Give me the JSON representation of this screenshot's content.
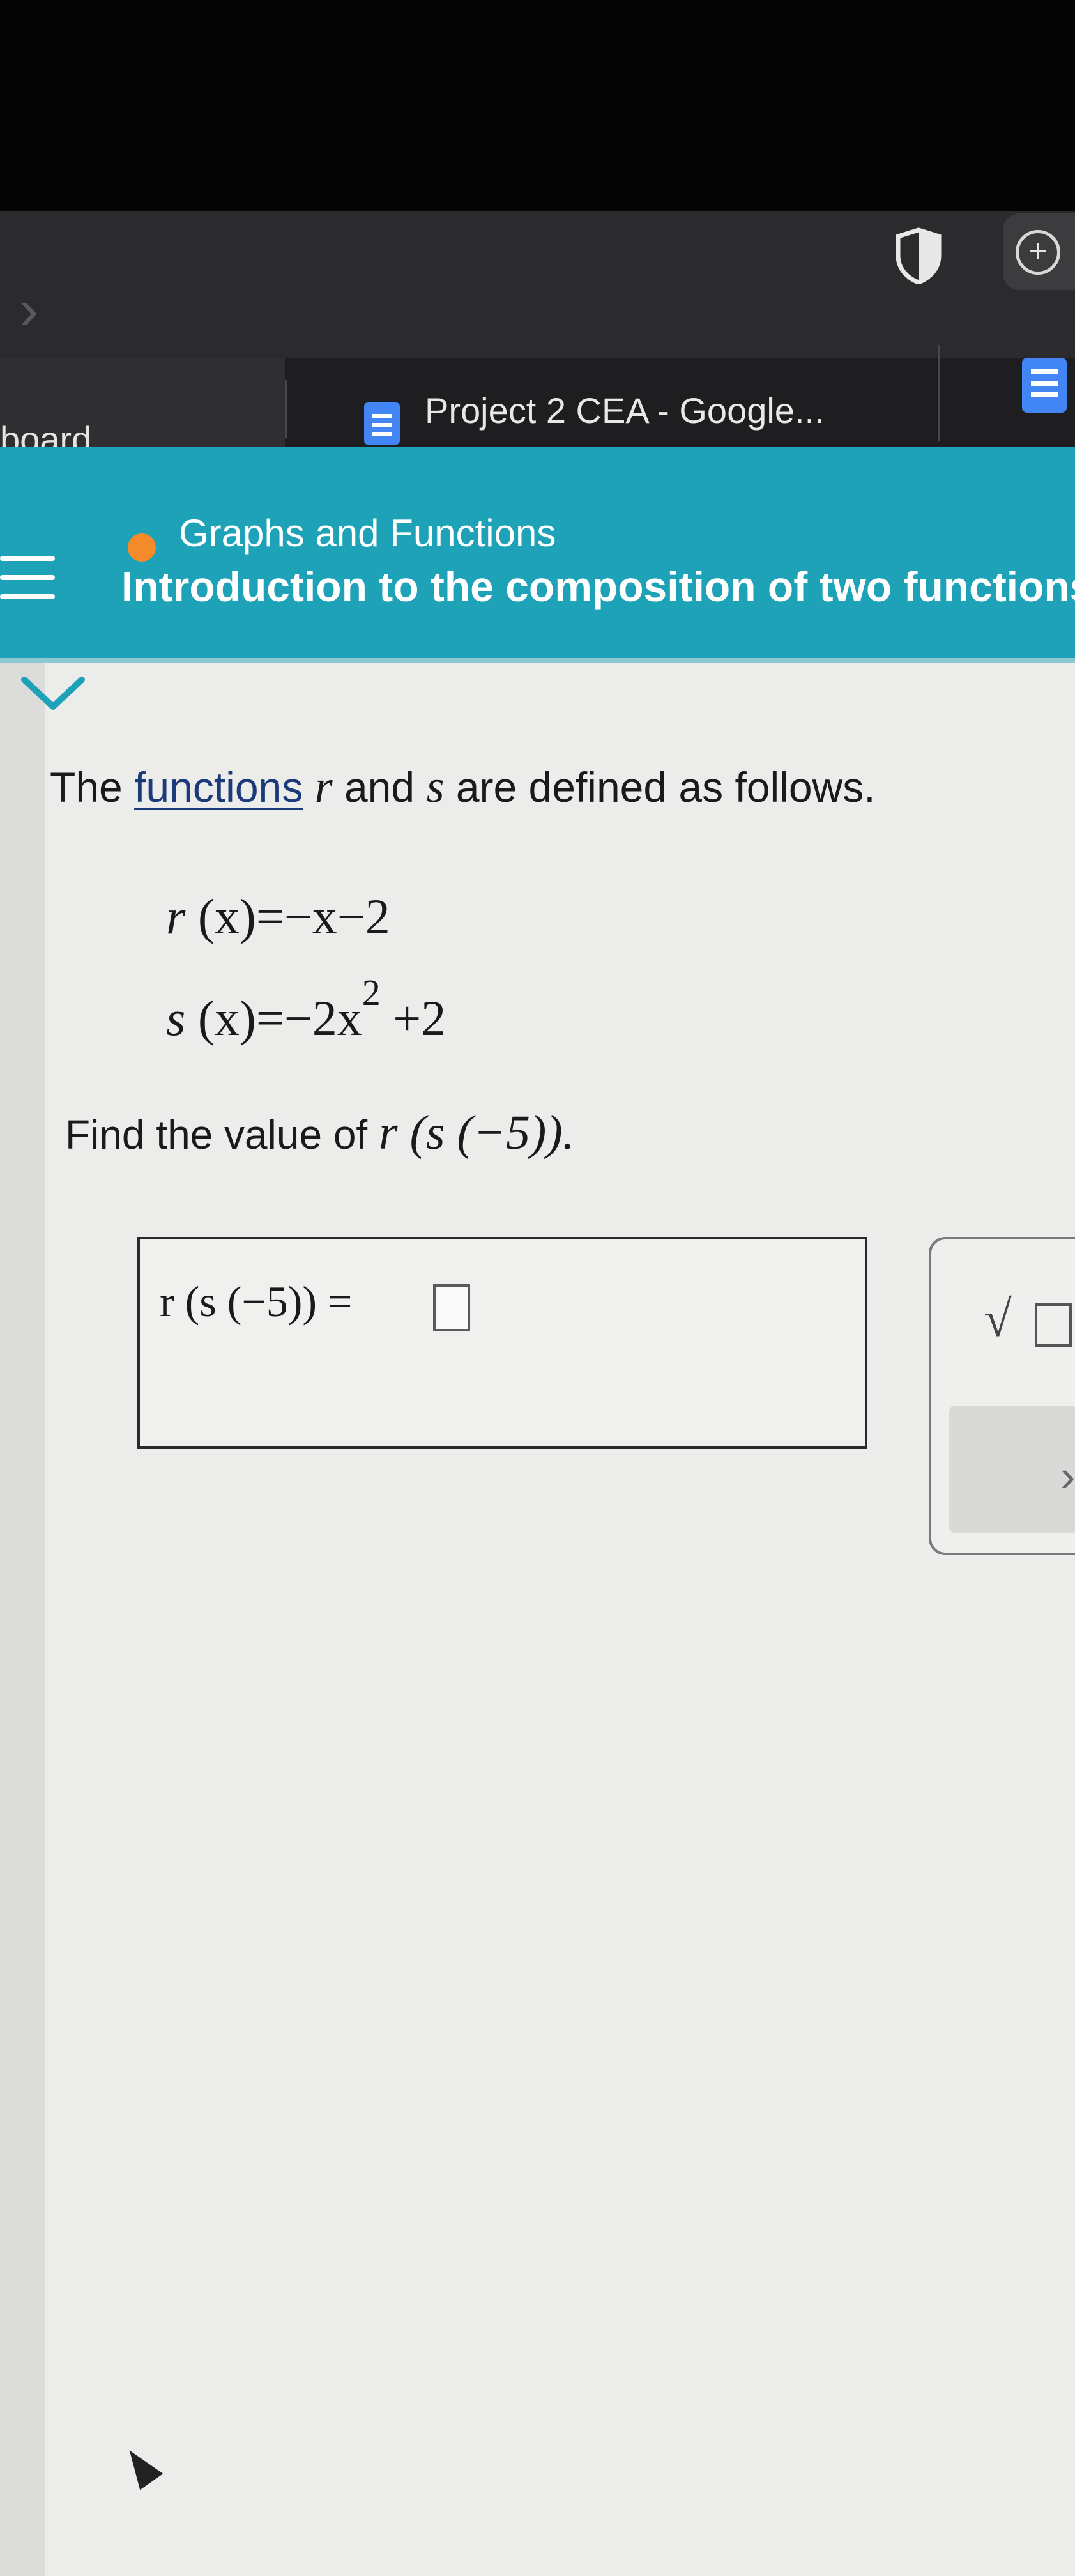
{
  "browser": {
    "tabs": [
      {
        "label": "board",
        "icon": "none"
      },
      {
        "label": "Project 2 CEA - Google...",
        "icon": "docs-icon"
      }
    ],
    "shield_icon": "shield-icon",
    "extension_icon": "plus-circle-icon"
  },
  "header": {
    "topic": "Graphs and Functions",
    "lesson_title": "Introduction to the composition of two functions",
    "topic_dot_color": "#f58a2a",
    "band_color": "#1ea2b8"
  },
  "problem": {
    "intro_prefix": "The ",
    "intro_link": "functions",
    "intro_r": "r",
    "intro_and": "and",
    "intro_s": "s",
    "intro_suffix": "are defined as follows.",
    "eq1_name": "r",
    "eq1_arg": "(x)",
    "eq1_rhs": "=−x−2",
    "eq2_name": "s",
    "eq2_arg": "(x)",
    "eq2_rhs_a": "=−2x",
    "eq2_exp": "2",
    "eq2_rhs_b": " +2",
    "find_prefix": "Find the value of ",
    "find_expr": "r (s (−5)).",
    "answer_label": "r (s (−5)) ="
  },
  "tools": {
    "sqrt_symbol": "√",
    "next_symbol": "›"
  }
}
